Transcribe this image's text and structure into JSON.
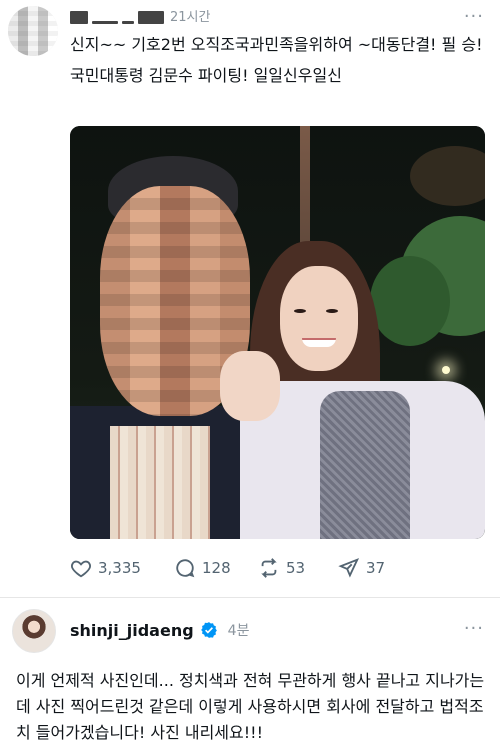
{
  "post": {
    "author_name_redacted": "",
    "time": "21시간",
    "more_label": "···",
    "text_lines": [
      "신지~~ 기호2번  오직조국과민족을위하여 ~대동단결! 필 승!",
      "국민대통령 김문수 파이팅! 일일신우일신"
    ],
    "stats": {
      "likes": "3,335",
      "replies": "128",
      "reposts": "53",
      "shares": "37"
    }
  },
  "reply": {
    "username": "shinji_jidaeng",
    "time": "4분",
    "more_label": "···",
    "text": "이게 언제적 사진인데... 정치색과 전혀 무관하게 행사 끝나고 지나가는데 사진 찍어드린것 같은데 이렇게 사용하시면 회사에 전달하고 법적조치 들어가겠습니다! 사진 내리세요!!!"
  },
  "colors": {
    "text": "#0f1419",
    "muted": "#8b959e",
    "icon": "#536471",
    "verified": "#0095f6"
  },
  "icons": [
    "heart-icon",
    "comment-icon",
    "repost-icon",
    "share-icon",
    "verified-badge-icon",
    "more-icon"
  ]
}
